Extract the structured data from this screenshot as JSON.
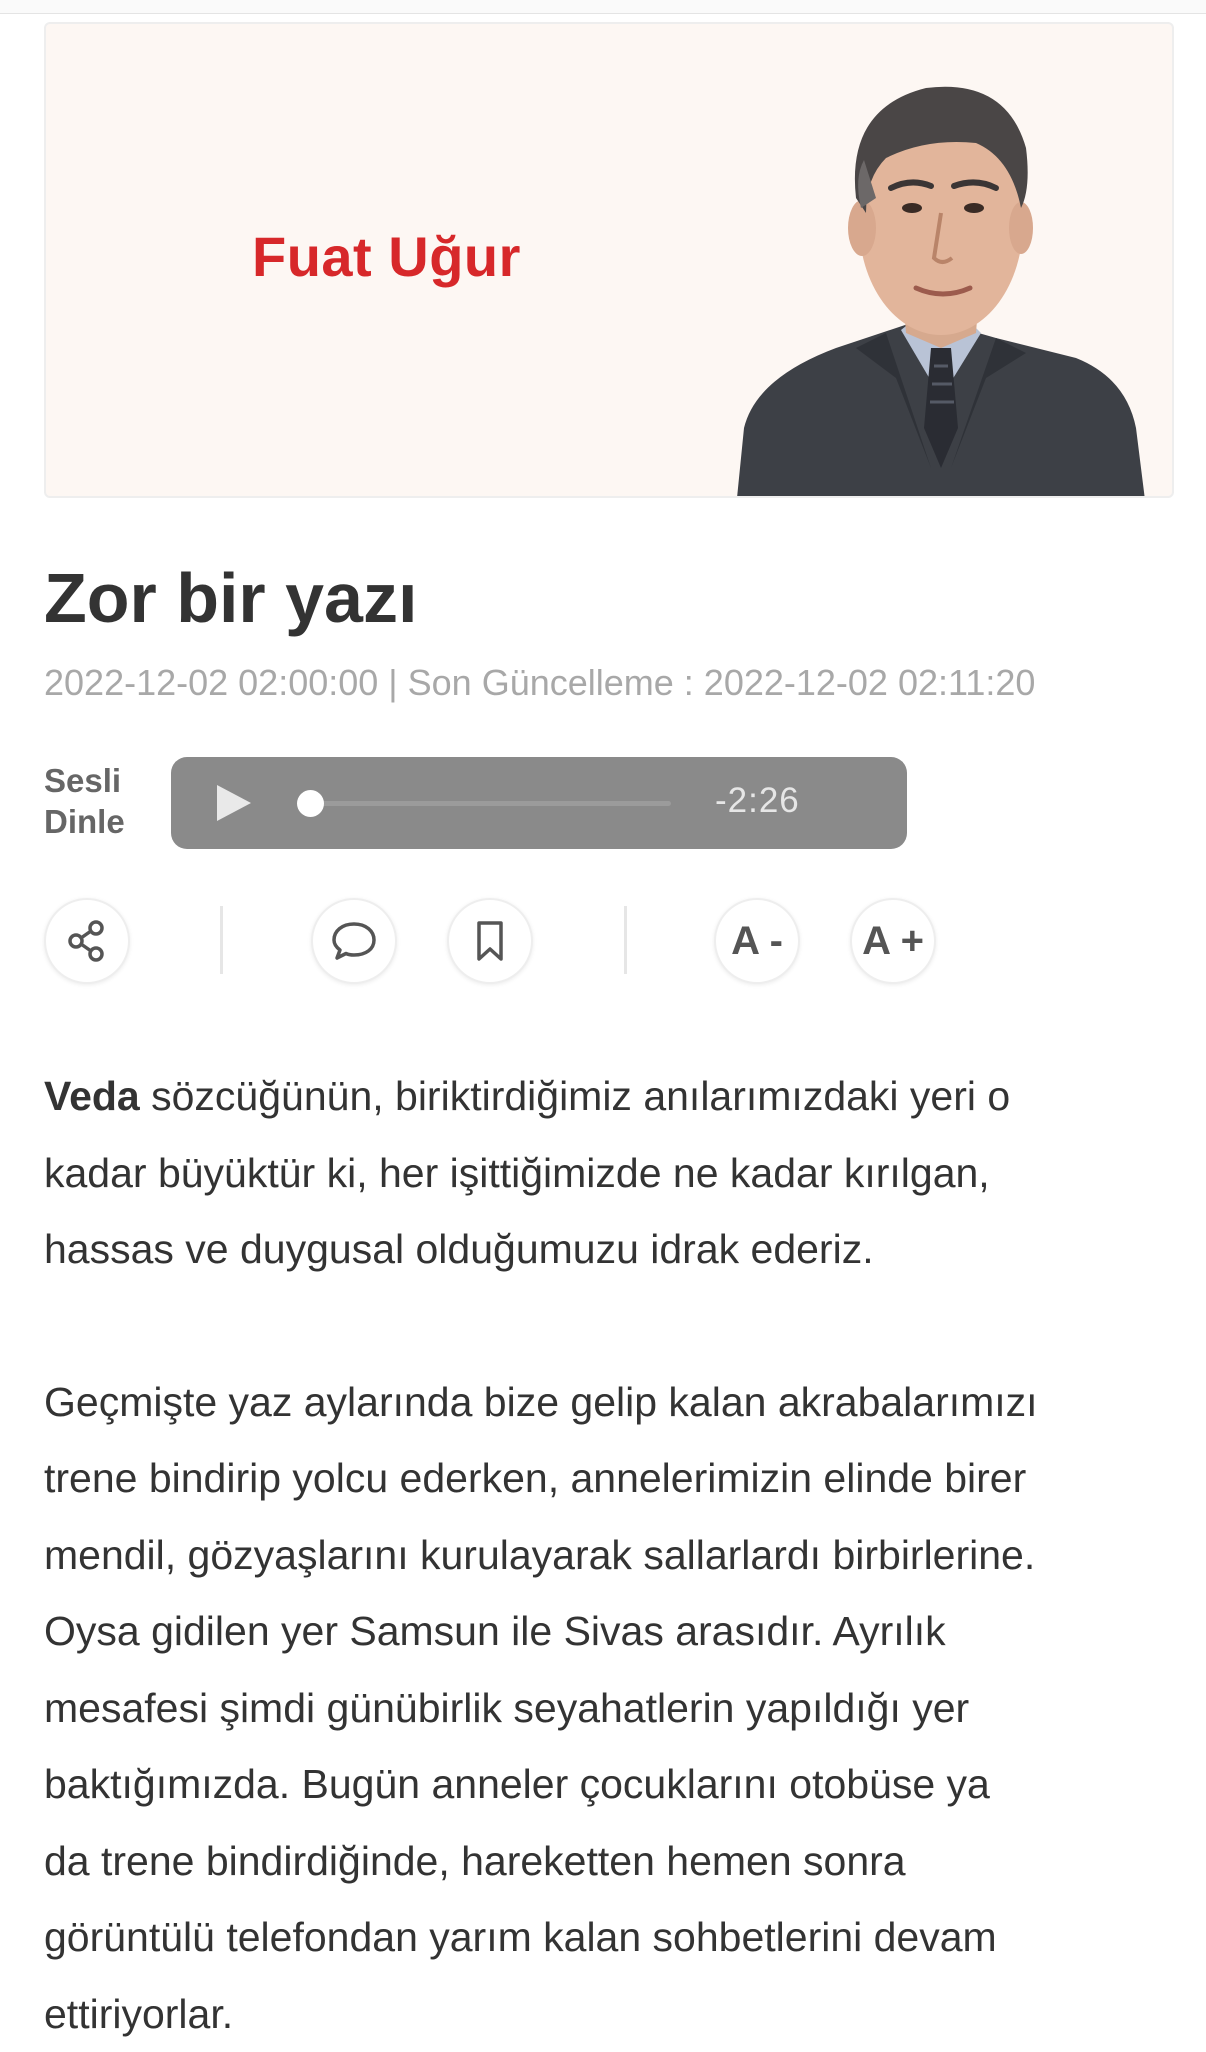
{
  "author": {
    "name": "Fuat Uğur"
  },
  "article": {
    "title": "Zor bir yazı",
    "dateline": "2022-12-02 02:00:00 | Son Güncelleme : 2022-12-02 02:11:20",
    "paragraph1_lead": "Veda",
    "paragraph1_lines": [
      " sözcüğünün, biriktirdiğimiz anılarımızdaki yeri o",
      "kadar büyüktür ki, her işittiğimizde ne kadar kırılgan,",
      "hassas ve duygusal olduğumuzu idrak ederiz."
    ],
    "paragraph2_lines": [
      "Geçmişte yaz aylarında bize gelip kalan akrabalarımızı",
      "trene bindirip yolcu ederken, annelerimizin elinde birer",
      "mendil, gözyaşlarını kurulayarak sallarlardı birbirlerine.",
      "Oysa gidilen yer Samsun ile Sivas arasıdır. Ayrılık",
      "mesafesi şimdi günübirlik seyahatlerin yapıldığı yer",
      "baktığımızda. Bugün anneler çocuklarını otobüse ya",
      "da trene bindirdiğinde, hareketten hemen sonra",
      "görüntülü telefondan yarım kalan sohbetlerini devam",
      "ettiriyorlar."
    ]
  },
  "audio": {
    "label_line1": "Sesli",
    "label_line2": "Dinle",
    "time_remaining": "-2:26",
    "progress": 0.0
  },
  "toolbar": {
    "font_decrease_label": "A -",
    "font_increase_label": "A +",
    "icons": [
      "share-icon",
      "comment-icon",
      "bookmark-icon"
    ]
  },
  "colors": {
    "author_name": "#d7282a",
    "card_bg": "#fdf7f3",
    "player_bg": "#8a8a8a",
    "text": "#333333",
    "muted": "#a8a8a8"
  }
}
